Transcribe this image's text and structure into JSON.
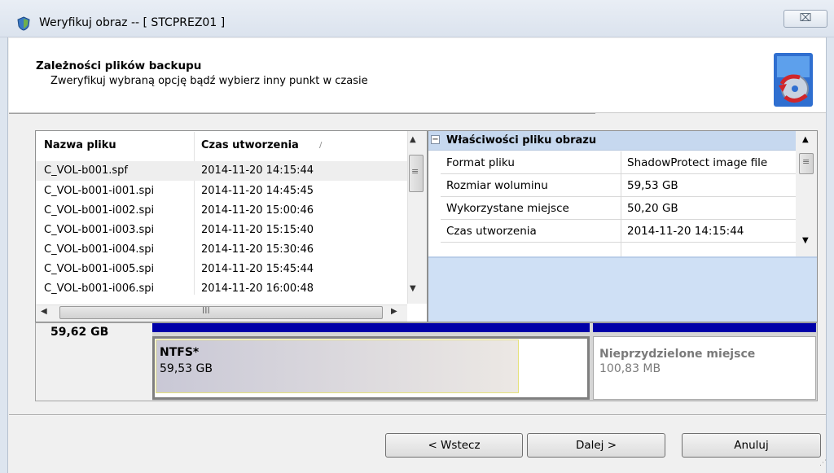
{
  "window": {
    "title": "Weryfikuj obraz -- [ STCPREZ01 ]",
    "close_glyph": "⌧"
  },
  "header": {
    "title": "Zależności plików backupu",
    "subtitle": "Zweryfikuj wybraną opcję bądź wybierz inny punkt w czasie"
  },
  "file_list": {
    "columns": [
      "Nazwa pliku",
      "Czas utworzenia"
    ],
    "sort_glyph": "/",
    "rows": [
      {
        "name": "C_VOL-b001.spf",
        "time": "2014-11-20 14:15:44"
      },
      {
        "name": "C_VOL-b001-i001.spi",
        "time": "2014-11-20 14:45:45"
      },
      {
        "name": "C_VOL-b001-i002.spi",
        "time": "2014-11-20 15:00:46"
      },
      {
        "name": "C_VOL-b001-i003.spi",
        "time": "2014-11-20 15:15:40"
      },
      {
        "name": "C_VOL-b001-i004.spi",
        "time": "2014-11-20 15:30:46"
      },
      {
        "name": "C_VOL-b001-i005.spi",
        "time": "2014-11-20 15:45:44"
      },
      {
        "name": "C_VOL-b001-i006.spi",
        "time": "2014-11-20 16:00:48"
      }
    ],
    "scroll_grip": "≡",
    "hscroll_grip": "III"
  },
  "properties": {
    "section_title": "Właściwości pliku obrazu",
    "collapse_glyph": "−",
    "rows": [
      {
        "key": "Format pliku",
        "value": "ShadowProtect image file"
      },
      {
        "key": "Rozmiar woluminu",
        "value": "59,53 GB"
      },
      {
        "key": "Wykorzystane miejsce",
        "value": "50,20 GB"
      },
      {
        "key": "Czas utworzenia",
        "value": "2014-11-20 14:15:44"
      }
    ]
  },
  "disk": {
    "total_size": "59,62 GB",
    "partitions": [
      {
        "name": "NTFS*",
        "size": "59,53 GB",
        "color": "#0000a8"
      },
      {
        "name": "Nieprzydzielone miejsce",
        "size": "100,83 MB",
        "color": "#0000a8"
      }
    ]
  },
  "footer": {
    "back_label": "< Wstecz",
    "next_label": "Dalej >",
    "cancel_label": "Anuluj"
  },
  "arrows": {
    "up": "▲",
    "down": "▼",
    "left": "◀",
    "right": "▶"
  }
}
